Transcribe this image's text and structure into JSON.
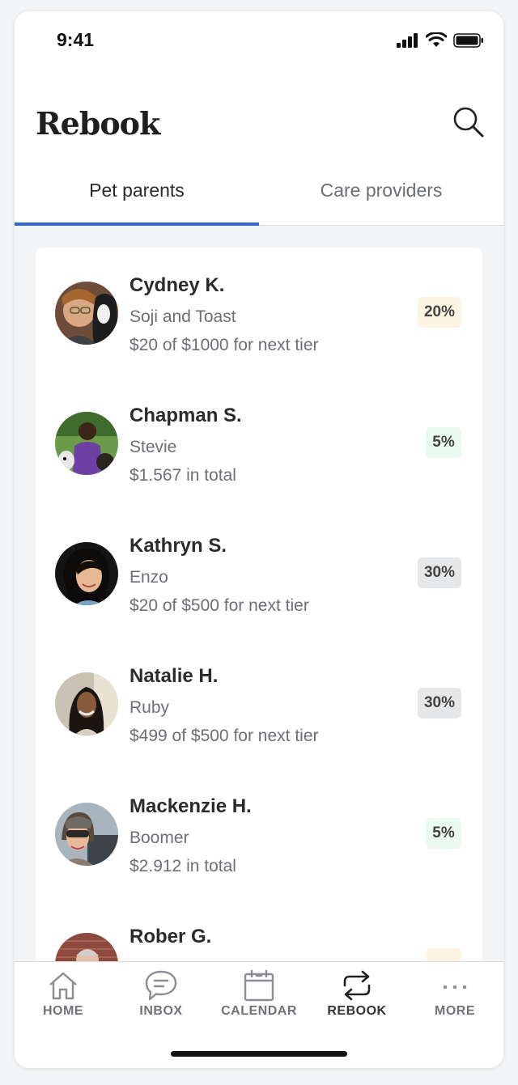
{
  "status": {
    "time": "9:41"
  },
  "header": {
    "title": "Rebook"
  },
  "tabs": [
    {
      "label": "Pet parents",
      "active": true
    },
    {
      "label": "Care providers",
      "active": false
    }
  ],
  "rows": [
    {
      "name": "Cydney K.",
      "pets": "Soji and Toast",
      "detail": "$20 of $1000 for next tier",
      "badge": "20%",
      "badge_color": "#fdf4e3"
    },
    {
      "name": "Chapman S.",
      "pets": "Stevie",
      "detail": "$1.567 in total",
      "badge": "5%",
      "badge_color": "#eafaf1"
    },
    {
      "name": "Kathryn S.",
      "pets": "Enzo",
      "detail": "$20 of $500 for next tier",
      "badge": "30%",
      "badge_color": "#e6e7e8"
    },
    {
      "name": "Natalie H.",
      "pets": "Ruby",
      "detail": "$499 of $500 for next tier",
      "badge": "30%",
      "badge_color": "#e6e7e8"
    },
    {
      "name": "Mackenzie H.",
      "pets": "Boomer",
      "detail": "$2.912 in total",
      "badge": "5%",
      "badge_color": "#eafaf1"
    },
    {
      "name": "Rober G.",
      "pets": "",
      "detail": "",
      "badge": "",
      "badge_color": "#fdf4e3"
    }
  ],
  "nav": [
    {
      "label": "HOME",
      "icon": "home-icon",
      "active": false
    },
    {
      "label": "INBOX",
      "icon": "chat-bubble-icon",
      "active": false
    },
    {
      "label": "CALENDAR",
      "icon": "calendar-icon",
      "active": false
    },
    {
      "label": "REBOOK",
      "icon": "rebook-arrows-icon",
      "active": true
    },
    {
      "label": "MORE",
      "icon": "more-dots-icon",
      "active": false
    }
  ],
  "colors": {
    "accent": "#3467d1",
    "background": "#f4f5f6"
  }
}
